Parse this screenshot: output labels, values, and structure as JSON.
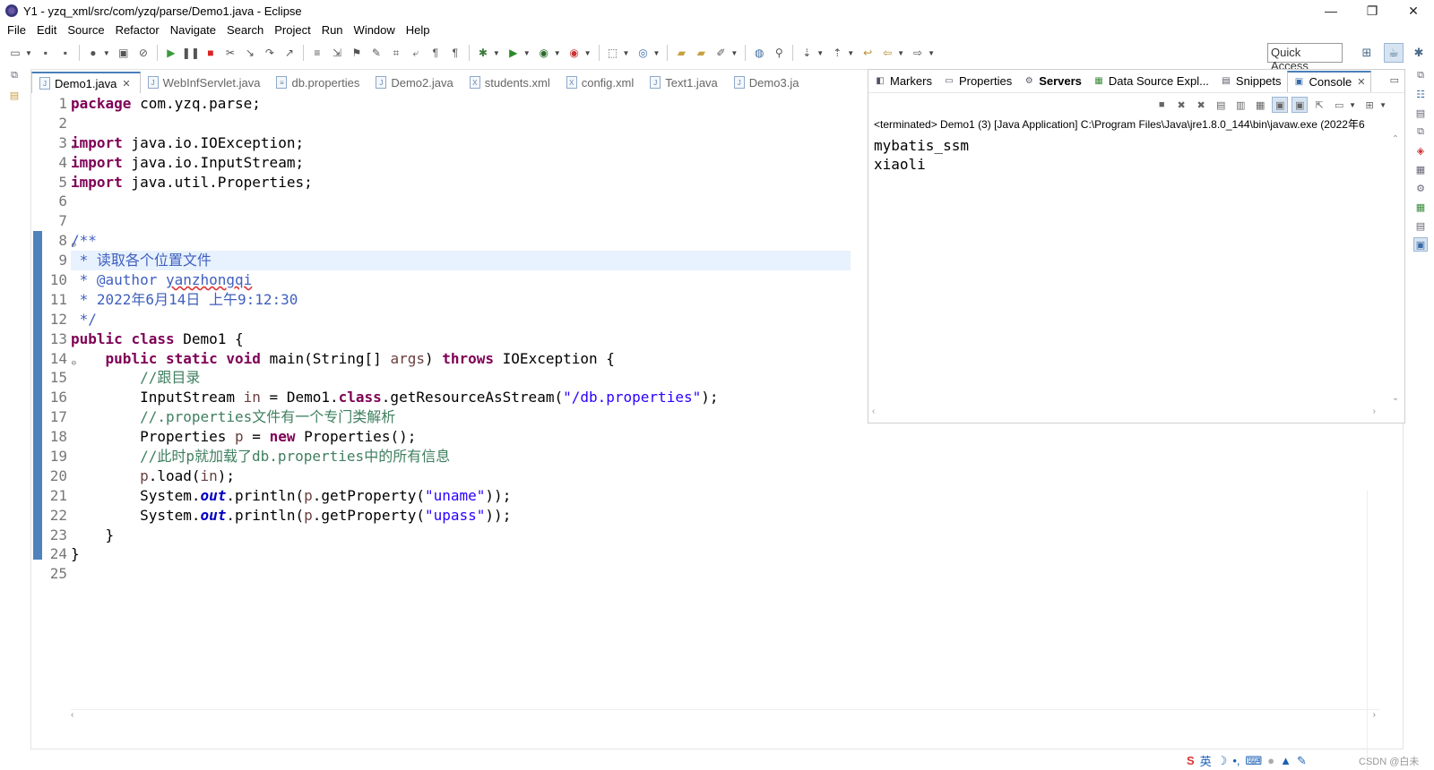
{
  "window": {
    "title": "Y1 - yzq_xml/src/com/yzq/parse/Demo1.java - Eclipse",
    "controls": [
      "—",
      "❐",
      "✕"
    ]
  },
  "menu": [
    "File",
    "Edit",
    "Source",
    "Refactor",
    "Navigate",
    "Search",
    "Project",
    "Run",
    "Window",
    "Help"
  ],
  "toolbar": {
    "quick_access": "Quick Access"
  },
  "editor": {
    "tabs": [
      {
        "label": "Demo1.java",
        "active": true,
        "close": "✕"
      },
      {
        "label": "WebInfServlet.java"
      },
      {
        "label": "db.properties"
      },
      {
        "label": "Demo2.java"
      },
      {
        "label": "students.xml"
      },
      {
        "label": "config.xml"
      },
      {
        "label": "Text1.java"
      },
      {
        "label": "Demo3.ja"
      }
    ],
    "line_numbers": [
      "1",
      "2",
      "3",
      "4",
      "5",
      "6",
      "7",
      "8",
      "9",
      "10",
      "11",
      "12",
      "13",
      "14",
      "15",
      "16",
      "17",
      "18",
      "19",
      "20",
      "21",
      "22",
      "23",
      "24",
      "25"
    ],
    "code": {
      "l1_kw": "package",
      "l1_rest": " com.yzq.parse;",
      "l3_kw": "import",
      "l3_rest": " java.io.IOException;",
      "l4_kw": "import",
      "l4_rest": " java.io.InputStream;",
      "l5_kw": "import",
      "l5_rest": " java.util.Properties;",
      "l8": "/**",
      "l9": " * 读取各个位置文件",
      "l10_a": " * @author ",
      "l10_b": "yanzhongqi",
      "l11": " * 2022年6月14日 上午9:12:30",
      "l12": " */",
      "l13_kw1": "public",
      "l13_kw2": "class",
      "l13_rest": " Demo1 {",
      "l14_indent": "    ",
      "l14_kw1": "public",
      "l14_kw2": "static",
      "l14_kw3": "void",
      "l14_sig": " main(String[] ",
      "l14_var": "args",
      "l14_paren": ") ",
      "l14_kw4": "throws",
      "l14_end": " IOException {",
      "l15": "        //跟目录",
      "l16_a": "        InputStream ",
      "l16_var": "in",
      "l16_b": " = Demo1.",
      "l16_kw": "class",
      "l16_c": ".getResourceAsStream(",
      "l16_str": "\"/db.properties\"",
      "l16_d": ");",
      "l17": "        //.properties文件有一个专门类解析",
      "l18_a": "        Properties ",
      "l18_var": "p",
      "l18_b": " = ",
      "l18_kw": "new",
      "l18_c": " Properties();",
      "l19": "        //此时p就加载了db.properties中的所有信息",
      "l20_a": "        ",
      "l20_var": "p",
      "l20_b": ".load(",
      "l20_var2": "in",
      "l20_c": ");",
      "l21_a": "        System.",
      "l21_fld": "out",
      "l21_b": ".println(",
      "l21_var": "p",
      "l21_c": ".getProperty(",
      "l21_str": "\"uname\"",
      "l21_d": "));",
      "l22_a": "        System.",
      "l22_fld": "out",
      "l22_b": ".println(",
      "l22_var": "p",
      "l22_c": ".getProperty(",
      "l22_str": "\"upass\"",
      "l22_d": "));",
      "l23": "    }",
      "l24": "}"
    }
  },
  "console": {
    "tabs": [
      {
        "label": "Markers",
        "icon": "markers-icon"
      },
      {
        "label": "Properties",
        "icon": "properties-icon"
      },
      {
        "label": "Servers",
        "icon": "servers-icon",
        "bold": true
      },
      {
        "label": "Data Source Expl...",
        "icon": "data-source-icon"
      },
      {
        "label": "Snippets",
        "icon": "snippets-icon"
      },
      {
        "label": "Console",
        "icon": "console-icon",
        "active": true,
        "close": "✕"
      }
    ],
    "terminated": "<terminated> Demo1 (3) [Java Application] C:\\Program Files\\Java\\jre1.8.0_144\\bin\\javaw.exe (2022年6",
    "output": [
      "mybatis_ssm",
      "xiaoli"
    ]
  },
  "statusbar": {
    "ime": "S",
    "lang": "英",
    "watermark": "CSDN @白未"
  },
  "colors": {
    "keyword": "#7f0055",
    "comment": "#3f7f5f",
    "javadoc": "#3f5fbf",
    "string": "#2a00ff",
    "local_var": "#6a3e3e",
    "static_field": "#0000c0",
    "change_bar": "#4f81bd"
  }
}
